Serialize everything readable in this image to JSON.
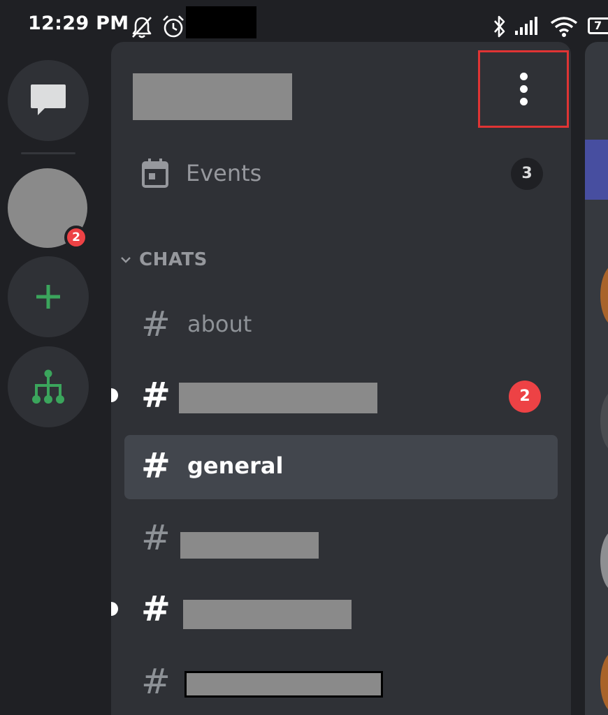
{
  "status_bar": {
    "time": "12:29 PM",
    "battery_level": "7",
    "icons": [
      "mute-notification-icon",
      "alarm-icon",
      "bluetooth-icon",
      "signal-icon",
      "wifi-icon",
      "battery-icon"
    ]
  },
  "server_rail": {
    "items": [
      {
        "name": "direct-messages",
        "icon": "chat-bubble-icon"
      },
      {
        "name": "server",
        "badge": "2"
      },
      {
        "name": "add-server",
        "icon": "plus-icon"
      },
      {
        "name": "explore-servers",
        "icon": "hierarchy-icon"
      }
    ],
    "badge_color": "#ed4245",
    "accent_color": "#3ba55c"
  },
  "channel_panel": {
    "server_name_redacted": true,
    "more_options_icon": "vertical-dots-icon",
    "highlight_color": "#e03434",
    "events": {
      "label": "Events",
      "count": "3"
    },
    "category": {
      "label": "CHATS"
    },
    "channels": [
      {
        "label": "about",
        "state": "read"
      },
      {
        "label": "",
        "redacted": true,
        "state": "unread",
        "mentions": "2"
      },
      {
        "label": "general",
        "state": "selected"
      },
      {
        "label": "",
        "redacted": true,
        "state": "read"
      },
      {
        "label": "",
        "redacted": true,
        "state": "unread"
      },
      {
        "label": "",
        "redacted": true,
        "state": "read"
      }
    ]
  }
}
